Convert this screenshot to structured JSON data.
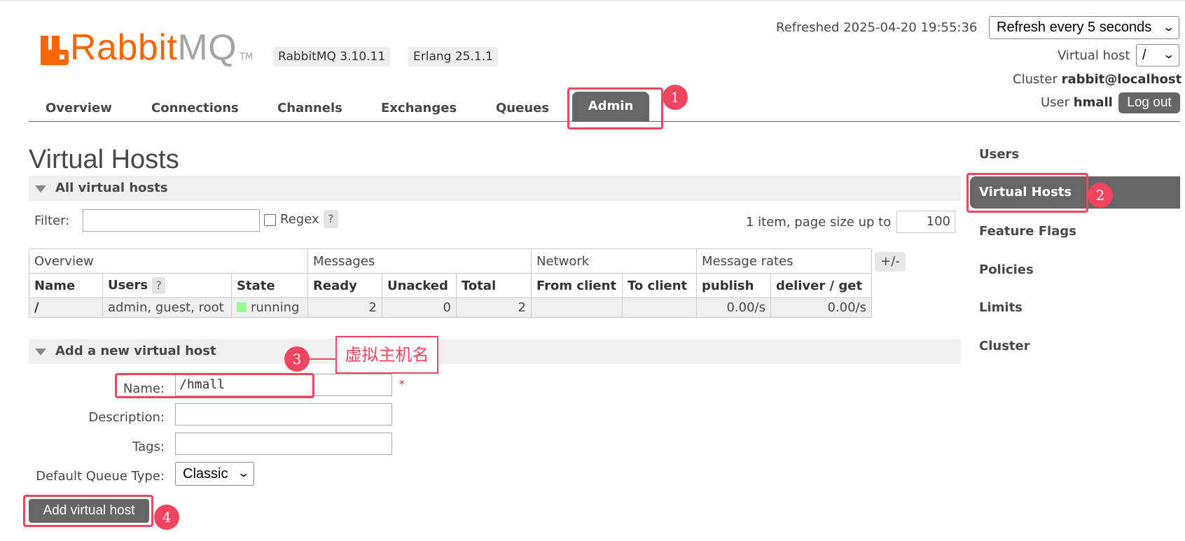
{
  "header": {
    "logo_text_rabbit": "Rabbit",
    "logo_text_mq": "MQ",
    "logo_tm": "TM",
    "versions": [
      "RabbitMQ 3.10.11",
      "Erlang 25.1.1"
    ],
    "refreshed_text": "Refreshed 2025-04-20 19:55:36",
    "refresh_select": "Refresh every 5 seconds",
    "vhost_label": "Virtual host",
    "vhost_select": "/",
    "cluster_label": "Cluster",
    "cluster_value": "rabbit@localhost",
    "user_label": "User",
    "user_value": "hmall",
    "logout": "Log out",
    "select_chevron": "⌄"
  },
  "nav": {
    "tabs": [
      "Overview",
      "Connections",
      "Channels",
      "Exchanges",
      "Queues",
      "Admin"
    ],
    "active": "Admin"
  },
  "sidebar": {
    "items": [
      "Users",
      "Virtual Hosts",
      "Feature Flags",
      "Policies",
      "Limits",
      "Cluster"
    ],
    "active": "Virtual Hosts"
  },
  "main": {
    "title": "Virtual Hosts",
    "list_section": "All virtual hosts",
    "filter_label": "Filter:",
    "filter_value": "",
    "regex_label": "Regex",
    "help_mark": "?",
    "pager_text": "1 item, page size up to",
    "page_size": "100",
    "table": {
      "groups": [
        "Overview",
        "Messages",
        "Network",
        "Message rates"
      ],
      "columns": [
        "Name",
        "Users",
        "State",
        "Ready",
        "Unacked",
        "Total",
        "From client",
        "To client",
        "publish",
        "deliver / get"
      ],
      "rows": [
        {
          "name": "/",
          "users": "admin, guest, root",
          "state": "running",
          "ready": "2",
          "unacked": "0",
          "total": "2",
          "from_client": "",
          "to_client": "",
          "publish": "0.00/s",
          "deliver_get": "0.00/s"
        }
      ],
      "toggle_columns": "+/-"
    },
    "add_section": "Add a new virtual host",
    "form": {
      "name_label": "Name:",
      "name_value": "/hmall",
      "required_mark": "*",
      "description_label": "Description:",
      "description_value": "",
      "tags_label": "Tags:",
      "tags_value": "",
      "queue_type_label": "Default Queue Type:",
      "queue_type_value": "Classic",
      "submit": "Add virtual host"
    }
  },
  "annotations": {
    "steps": [
      "1",
      "2",
      "3",
      "4"
    ],
    "note": "虚拟主机名",
    "color": "#f0455f"
  },
  "colors": {
    "brand_orange": "#ff6600",
    "active_tab": "#666666",
    "running_state": "#98f898"
  }
}
